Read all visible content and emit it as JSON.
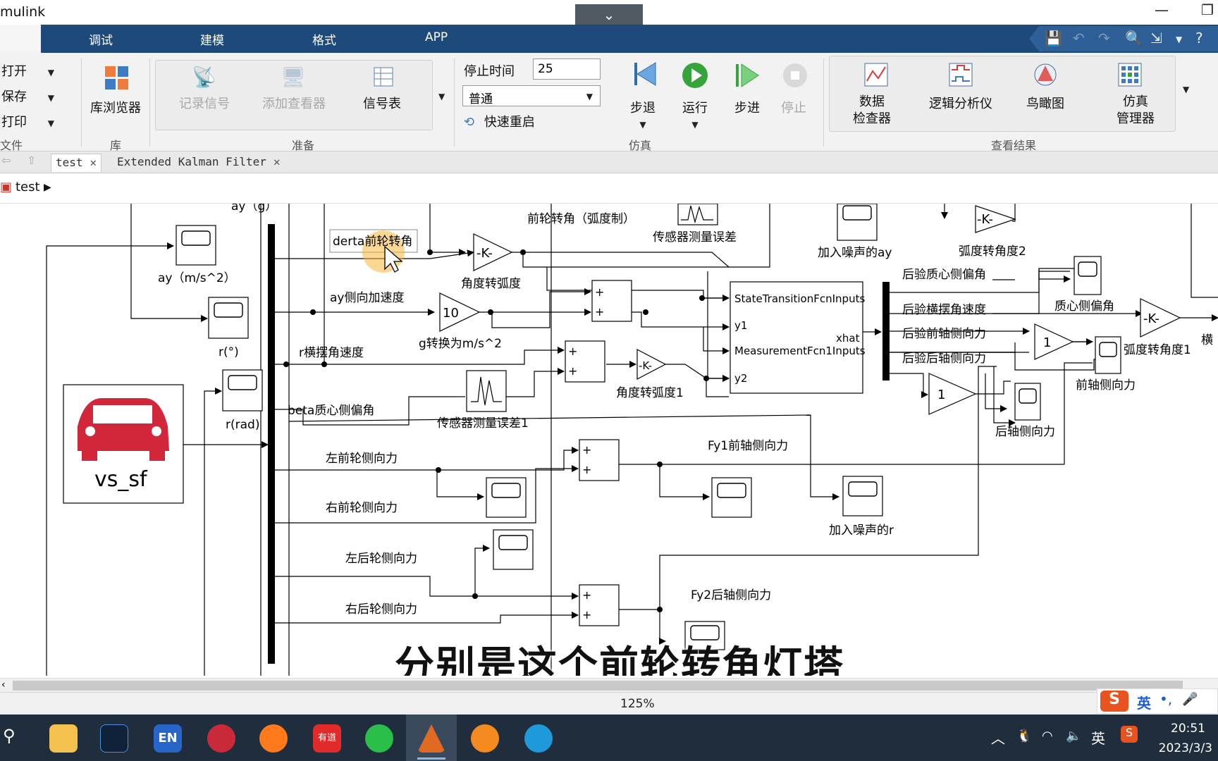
{
  "window": {
    "title": "mulink"
  },
  "ribbon_tabs": [
    "调试",
    "建模",
    "格式",
    "APP"
  ],
  "file_group": {
    "items": [
      "打开",
      "保存",
      "打印"
    ],
    "label": "文件"
  },
  "library_group": {
    "button": "库浏览器",
    "label": "库"
  },
  "prepare_group": {
    "buttons": [
      "记录信号",
      "添加查看器",
      "信号表"
    ],
    "label": "准备"
  },
  "simulate_group": {
    "stop_time_label": "停止时间",
    "stop_time_value": "25",
    "mode_value": "普通",
    "fast_restart": "快速重启",
    "buttons": [
      "步退",
      "运行",
      "步进",
      "停止"
    ],
    "label": "仿真"
  },
  "results_group": {
    "buttons": [
      "数据\n检查器",
      "逻辑分析仪",
      "鸟瞰图",
      "仿真\n管理器"
    ],
    "label": "查看结果"
  },
  "doc_tabs": [
    {
      "label": "test"
    },
    {
      "label": "Extended Kalman Filter"
    }
  ],
  "breadcrumb": {
    "model": "test"
  },
  "diagram": {
    "vehicle_block": "vs_sf",
    "labels": {
      "ay_top": "ay（g）",
      "ay_scope": "ay（m/s^2）",
      "r_deg": "r(°)",
      "r_rad": "r(rad)",
      "derta": "derta前轮转角",
      "ay_lat": "ay侧向加速度",
      "r_yaw": "r横摆角速度",
      "beta": "beta质心侧偏角",
      "lf": "左前轮侧向力",
      "rf": "右前轮侧向力",
      "lr": "左后轮侧向力",
      "rr": "右后轮侧向力",
      "deg2rad": "角度转弧度",
      "g_conv": "g转换为m/s^2",
      "sensor_err1": "传感器测量误差1",
      "deg2rad1": "角度转弧度1",
      "front_steer_rad": "前轮转角（弧度制）",
      "sensor_err": "传感器测量误差",
      "noise_ay": "加入噪声的ay",
      "noise_r": "加入噪声的r",
      "rad2deg2": "弧度转角度2",
      "post_beta": "后验质心侧偏角",
      "post_yaw": "后验横摆角速度",
      "post_front": "后验前轴侧向力",
      "post_rear": "后验后轴侧向力",
      "beta_scope": "质心侧偏角",
      "rad2deg1": "弧度转角度1",
      "front_axle": "前轴侧向力",
      "rear_axle": "后轴侧向力",
      "fy1": "Fy1前轴侧向力",
      "fy2": "Fy2后轴侧向力",
      "heng": "横"
    },
    "ekf_ports": {
      "in1": "StateTransitionFcnInputs",
      "in2": "y1",
      "in3": "MeasurementFcn1Inputs",
      "in4": "y2",
      "out": "xhat"
    },
    "gains": {
      "k": "-K-",
      "ten": "10",
      "one": "1",
      "plus": "+"
    }
  },
  "subtitle": "分别是这个前轮转角灯塔",
  "status": {
    "zoom": "125%"
  },
  "tray": {
    "ime": "英",
    "time": "20:51",
    "date": "2023/3/3"
  }
}
